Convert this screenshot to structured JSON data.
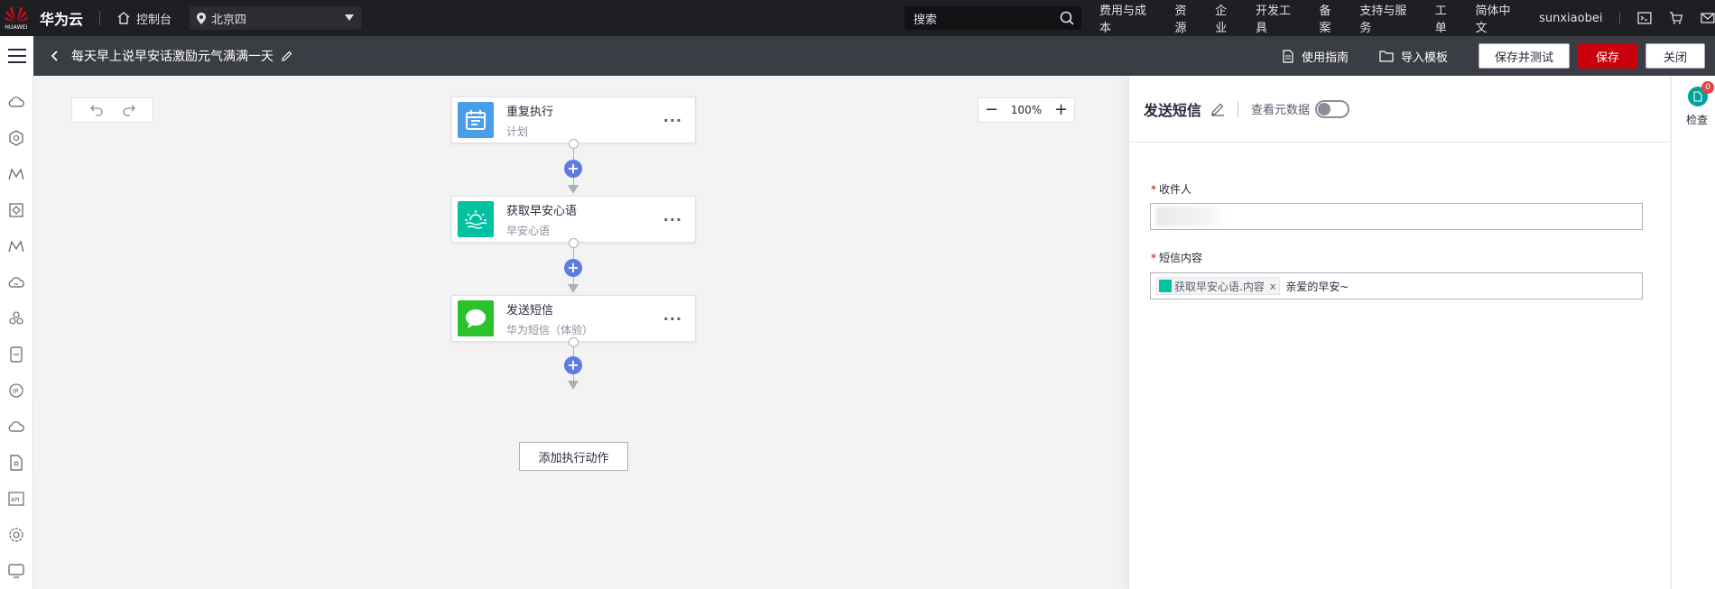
{
  "topbar": {
    "brand": "华为云",
    "logo_text": "HUAWEI",
    "console": "控制台",
    "region": "北京四",
    "search_placeholder": "搜索",
    "nav": [
      "费用与成本",
      "资源",
      "企业",
      "开发工具",
      "备案",
      "支持与服务",
      "工单",
      "简体中文",
      "sunxiaobei"
    ]
  },
  "subbar": {
    "title": "每天早上说早安话激励元气满满一天",
    "guide": "使用指南",
    "import_template": "导入模板",
    "save_and_test": "保存并测试",
    "save": "保存",
    "close": "关闭"
  },
  "canvas": {
    "zoom": "100%",
    "nodes": [
      {
        "title": "重复执行",
        "subtitle": "计划",
        "color": "#4a9de8"
      },
      {
        "title": "获取早安心语",
        "subtitle": "早安心语",
        "color": "#00c1a0"
      },
      {
        "title": "发送短信",
        "subtitle": "华为短信（体验）",
        "color": "#2bc22b"
      }
    ],
    "add_action": "添加执行动作"
  },
  "panel": {
    "title": "发送短信",
    "meta_label": "查看元数据",
    "recipient_label": "收件人",
    "recipient_value": "",
    "sms_label": "短信内容",
    "chip_label": "获取早安心语.内容",
    "chip_close": "x",
    "sms_text": "亲爱的早安~"
  },
  "rightrail": {
    "check_label": "检查",
    "badge": "0"
  },
  "colors": {
    "accent_red": "#c7000b",
    "plus_blue": "#5e7ce0",
    "topbar": "#1e1f23",
    "subbar": "#3b3d44"
  }
}
